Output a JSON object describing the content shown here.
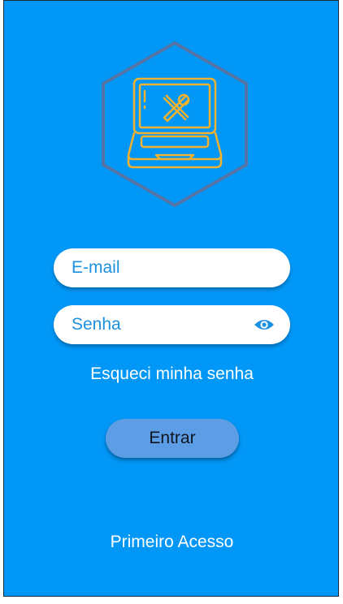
{
  "login": {
    "email_placeholder": "E-mail",
    "password_placeholder": "Senha",
    "forgot_label": "Esqueci minha senha",
    "submit_label": "Entrar",
    "first_access_label": "Primeiro Acesso"
  },
  "icons": {
    "logo": "laptop-tools-icon",
    "password_toggle": "eye-icon"
  },
  "colors": {
    "background": "#0097f7",
    "field_text": "#1e90e0",
    "button": "#5c9de5",
    "logo_stroke": "#f2b230",
    "hexagon": "#5474a5"
  }
}
